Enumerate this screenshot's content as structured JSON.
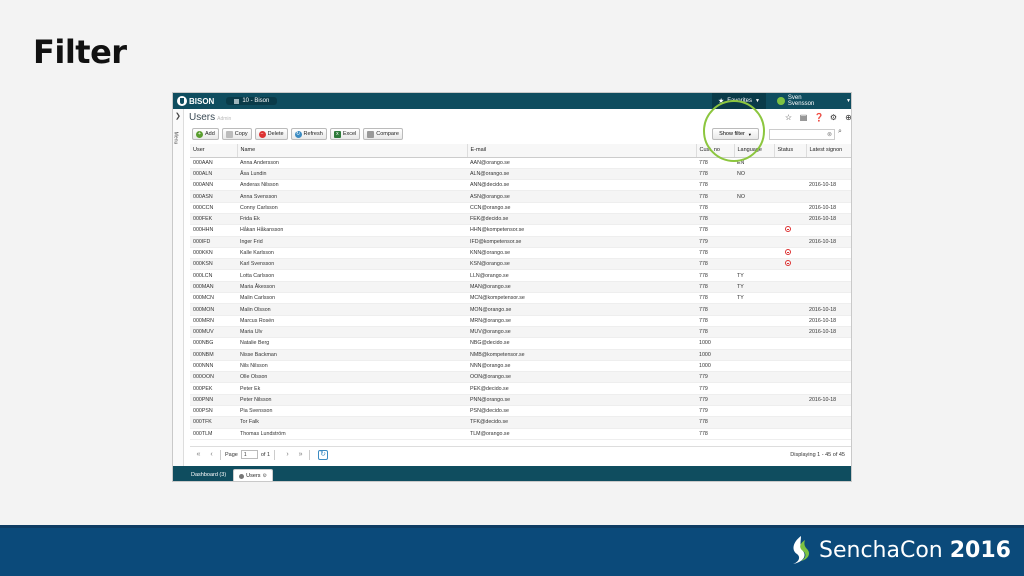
{
  "slide": {
    "title": "Filter"
  },
  "app": {
    "logo": "BISON",
    "company": "10 - Bison",
    "favorites": "Favorites",
    "user": "Sven Svensson",
    "menu_label": "Menu",
    "view_title": "Users",
    "view_sub": "Admin",
    "icons": [
      "star-outline-icon",
      "card-icon",
      "help-icon",
      "gear-icon",
      "add-icon"
    ]
  },
  "toolbar": {
    "add": "Add",
    "copy": "Copy",
    "delete": "Delete",
    "refresh": "Refresh",
    "excel": "Excel",
    "compare": "Compare",
    "show_filter": "Show filter"
  },
  "grid": {
    "columns": [
      "User",
      "Name",
      "E-mail",
      "Cust. no",
      "Language",
      "Status",
      "Latest signon"
    ],
    "rows": [
      [
        "000AAN",
        "Anna Andersson",
        "AAN@orango.se",
        "778",
        "EN",
        "",
        ""
      ],
      [
        "000ALN",
        "Åsa Lundin",
        "ALN@orango.se",
        "778",
        "NO",
        "",
        ""
      ],
      [
        "000ANN",
        "Anderas Nilsson",
        "ANN@decido.se",
        "778",
        "",
        "",
        "2016-10-18"
      ],
      [
        "000ASN",
        "Anna Svensson",
        "ASN@orango.se",
        "778",
        "NO",
        "",
        ""
      ],
      [
        "000CCN",
        "Conny Carlsson",
        "CCN@orango.se",
        "778",
        "",
        "",
        "2016-10-18"
      ],
      [
        "000FEK",
        "Frida Ek",
        "FEK@decido.se",
        "778",
        "",
        "",
        "2016-10-18"
      ],
      [
        "000HHN",
        "Håkan Håkansson",
        "HHN@kompetensor.se",
        "778",
        "",
        "blocked",
        ""
      ],
      [
        "000IFD",
        "Inger Frid",
        "IFD@kompetensor.se",
        "779",
        "",
        "",
        "2016-10-18"
      ],
      [
        "000KKN",
        "Kalle Karlsson",
        "KNN@orango.se",
        "778",
        "",
        "blocked",
        ""
      ],
      [
        "000KSN",
        "Karl Svensson",
        "KSN@orango.se",
        "778",
        "",
        "blocked",
        ""
      ],
      [
        "000LCN",
        "Lotta Carlsson",
        "LLN@orango.se",
        "778",
        "TY",
        "",
        ""
      ],
      [
        "000MAN",
        "Maria Åkesson",
        "MAN@orango.se",
        "778",
        "TY",
        "",
        ""
      ],
      [
        "000MCN",
        "Malin Carlsson",
        "MCN@kompetensor.se",
        "778",
        "TY",
        "",
        ""
      ],
      [
        "000MON",
        "Malin Olsson",
        "MON@orango.se",
        "778",
        "",
        "",
        "2016-10-18"
      ],
      [
        "000MRN",
        "Marcus Rosén",
        "MRN@orango.se",
        "778",
        "",
        "",
        "2016-10-18"
      ],
      [
        "000MUV",
        "Maria Ulv",
        "MUV@orango.se",
        "778",
        "",
        "",
        "2016-10-18"
      ],
      [
        "000NBG",
        "Natalie Berg",
        "NBG@decido.se",
        "1000",
        "",
        "",
        ""
      ],
      [
        "000NBM",
        "Nisse Backman",
        "NMB@kompetensor.se",
        "1000",
        "",
        "",
        ""
      ],
      [
        "000NNN",
        "Nils Nilsson",
        "NNN@orango.se",
        "1000",
        "",
        "",
        ""
      ],
      [
        "000OON",
        "Olle Olsson",
        "OON@orango.se",
        "779",
        "",
        "",
        ""
      ],
      [
        "000PEK",
        "Peter Ek",
        "PEK@decido.se",
        "779",
        "",
        "",
        ""
      ],
      [
        "000PNN",
        "Peter Nilsson",
        "PNN@orango.se",
        "779",
        "",
        "",
        "2016-10-18"
      ],
      [
        "000PSN",
        "Pia Svensson",
        "PSN@decido.se",
        "779",
        "",
        "",
        ""
      ],
      [
        "000TFK",
        "Tor Falk",
        "TFK@decido.se",
        "778",
        "",
        "",
        ""
      ],
      [
        "000TLM",
        "Thomas Lundström",
        "TLM@orango.se",
        "778",
        "",
        "",
        ""
      ]
    ]
  },
  "pager": {
    "page_label": "Page",
    "page_value": "1",
    "of_label": "of 1",
    "display": "Displaying 1 - 45 of 45"
  },
  "tabs": {
    "dashboard": "Dashboard (3)",
    "users": "Users"
  },
  "brand": {
    "name": "SenchaCon",
    "year": "2016"
  }
}
